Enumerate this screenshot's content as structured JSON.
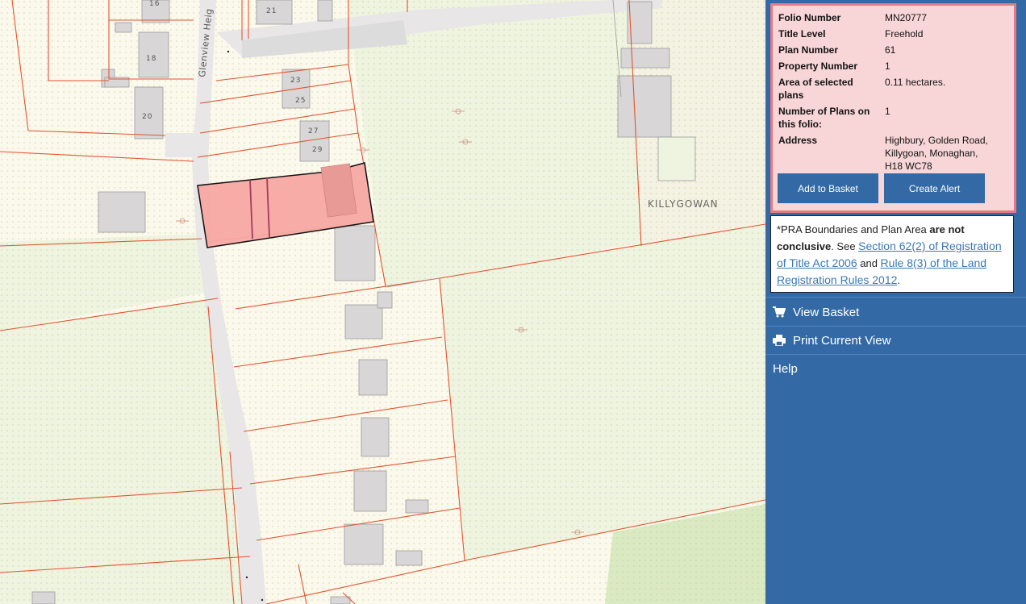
{
  "map": {
    "road_label": "Glenview Heig",
    "townland_label": "KILLYGOWAN",
    "building_numbers": [
      "16",
      "21",
      "18",
      "23",
      "25",
      "20",
      "27",
      "29"
    ]
  },
  "info": {
    "rows": [
      {
        "key": "Folio Number",
        "value": "MN20777"
      },
      {
        "key": "Title Level",
        "value": "Freehold"
      },
      {
        "key": "Plan Number",
        "value": "61"
      },
      {
        "key": "Property Number",
        "value": "1"
      },
      {
        "key": "Area of selected plans",
        "value": "0.11 hectares."
      },
      {
        "key": "Number of Plans on this folio:",
        "value": "1"
      },
      {
        "key": "Address",
        "value": "Highbury, Golden Road, Killygoan, Monaghan, H18 WC78"
      }
    ],
    "add_to_basket": "Add to Basket",
    "create_alert": "Create Alert"
  },
  "disclaimer": {
    "prefix": "*PRA Boundaries and Plan Area ",
    "bold": "are not conclusive",
    "mid": ". See ",
    "link1": "Section 62(2) of Registration of Title Act 2006",
    "and": " and ",
    "link2": "Rule 8(3) of the Land Registration Rules 2012",
    "end": "."
  },
  "menu": {
    "view_basket": "View Basket",
    "print_view": "Print Current View",
    "help": "Help"
  },
  "colors": {
    "panel_bg": "#336aa6",
    "info_bg": "#f8d6d8",
    "info_border": "#e57a82",
    "parcel_line": "#e4532f",
    "selected_fill": "#f7a8a3",
    "field_green": "#eef4df"
  }
}
